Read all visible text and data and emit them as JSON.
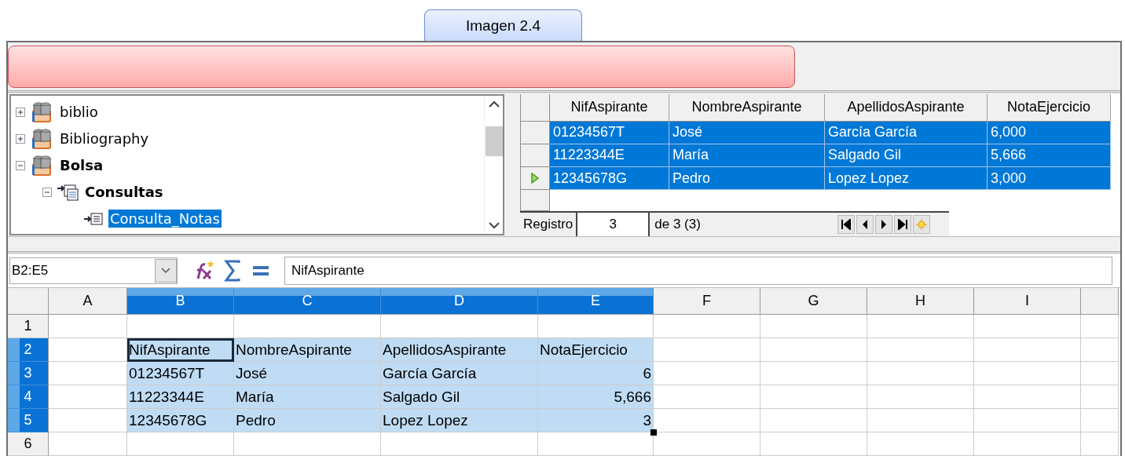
{
  "caption": "Imagen 2.4",
  "tree": [
    {
      "label": "biblio",
      "kind": "database",
      "expanded": false,
      "selected": false
    },
    {
      "label": "Bibliography",
      "kind": "database",
      "expanded": false,
      "selected": false
    },
    {
      "label": "Bolsa",
      "kind": "database",
      "expanded": true,
      "selected": false,
      "children": [
        {
          "label": "Consultas",
          "kind": "folder",
          "expanded": true,
          "selected": false,
          "children": [
            {
              "label": "Consulta_Notas",
              "kind": "query",
              "selected": true
            }
          ]
        }
      ]
    }
  ],
  "grid": {
    "columns": [
      "NifAspirante",
      "NombreAspirante",
      "ApellidosAspirante",
      "NotaEjercicio"
    ],
    "rows": [
      {
        "current": false,
        "selected": true,
        "cells": [
          "01234567T",
          "José",
          "García García",
          "6,000"
        ]
      },
      {
        "current": false,
        "selected": true,
        "cells": [
          "11223344E",
          "María",
          "Salgado Gil",
          "5,666"
        ]
      },
      {
        "current": true,
        "selected": true,
        "cells": [
          "12345678G",
          "Pedro",
          "Lopez Lopez",
          "3,000"
        ]
      }
    ],
    "navigator": {
      "label": "Registro",
      "value": "3",
      "total": "de 3 (3)"
    }
  },
  "formula_bar": {
    "name_box": "B2:E5",
    "content": "NifAspirante"
  },
  "sheet": {
    "columns": [
      {
        "label": "A",
        "selected": false
      },
      {
        "label": "B",
        "selected": true
      },
      {
        "label": "C",
        "selected": true
      },
      {
        "label": "D",
        "selected": true
      },
      {
        "label": "E",
        "selected": true
      },
      {
        "label": "F",
        "selected": false
      },
      {
        "label": "G",
        "selected": false
      },
      {
        "label": "H",
        "selected": false
      },
      {
        "label": "I",
        "selected": false
      }
    ],
    "rows": [
      {
        "label": "1",
        "selected": false,
        "cells": []
      },
      {
        "label": "2",
        "selected": true,
        "cells": [
          {
            "text": "",
            "kind": "text",
            "active": false
          },
          {
            "text": "NifAspirante",
            "kind": "text",
            "active": true
          },
          {
            "text": "NombreAspirante",
            "kind": "text",
            "active": false
          },
          {
            "text": "ApellidosAspirante",
            "kind": "text",
            "active": false
          },
          {
            "text": "NotaEjercicio",
            "kind": "text",
            "active": false
          }
        ]
      },
      {
        "label": "3",
        "selected": true,
        "cells": [
          {
            "text": "",
            "kind": "text",
            "active": false
          },
          {
            "text": "01234567T",
            "kind": "text",
            "active": false
          },
          {
            "text": "José",
            "kind": "text",
            "active": false
          },
          {
            "text": "García García",
            "kind": "text",
            "active": false
          },
          {
            "text": "6",
            "kind": "number",
            "active": false
          }
        ]
      },
      {
        "label": "4",
        "selected": true,
        "cells": [
          {
            "text": "",
            "kind": "text",
            "active": false
          },
          {
            "text": "11223344E",
            "kind": "text",
            "active": false
          },
          {
            "text": "María",
            "kind": "text",
            "active": false
          },
          {
            "text": "Salgado Gil",
            "kind": "text",
            "active": false
          },
          {
            "text": "5,666",
            "kind": "number",
            "active": false
          }
        ]
      },
      {
        "label": "5",
        "selected": true,
        "cells": [
          {
            "text": "",
            "kind": "text",
            "active": false
          },
          {
            "text": "12345678G",
            "kind": "text",
            "active": false
          },
          {
            "text": "Pedro",
            "kind": "text",
            "active": false
          },
          {
            "text": "Lopez Lopez",
            "kind": "text",
            "active": false
          },
          {
            "text": "3",
            "kind": "number",
            "active": false
          }
        ]
      },
      {
        "label": "6",
        "selected": false,
        "cells": []
      }
    ]
  }
}
